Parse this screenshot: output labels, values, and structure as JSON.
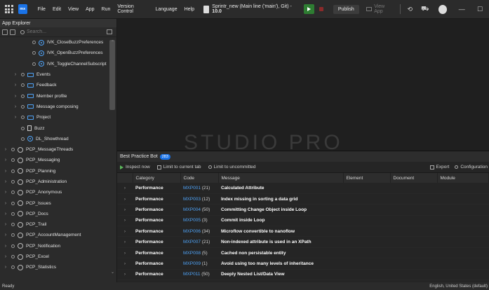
{
  "topbar": {
    "app_badge": "mx",
    "menu": [
      "File",
      "Edit",
      "View",
      "App",
      "Run",
      "Version Control",
      "Language",
      "Help"
    ],
    "project_name": "Sprintr_new (Main line ('main'), Git)",
    "project_sep": " - ",
    "project_version": "10.0",
    "publish_label": "Publish",
    "view_app_label": "View App"
  },
  "explorer": {
    "title": "App Explorer",
    "search_placeholder": "Search...",
    "items": [
      {
        "label": "IVK_CloseBuzzPreferences",
        "kind": "microflow",
        "indent": 38
      },
      {
        "label": "IVK_OpenBuzzPreferences",
        "kind": "microflow",
        "indent": 38
      },
      {
        "label": "IVK_ToggleChannelSubscript",
        "kind": "microflow",
        "indent": 38
      },
      {
        "label": "Events",
        "kind": "folder",
        "indent": 28
      },
      {
        "label": "Feedback",
        "kind": "folder",
        "indent": 28
      },
      {
        "label": "Member profile",
        "kind": "folder",
        "indent": 28
      },
      {
        "label": "Message composing",
        "kind": "folder",
        "indent": 28
      },
      {
        "label": "Project",
        "kind": "folder",
        "indent": 28
      },
      {
        "label": "Buzz",
        "kind": "doc",
        "indent": 28
      },
      {
        "label": "DL_Showthread",
        "kind": "microflow",
        "indent": 28
      },
      {
        "label": "PCP_MessageThreads",
        "kind": "module",
        "indent": 14
      },
      {
        "label": "PCP_Messaging",
        "kind": "module",
        "indent": 14
      },
      {
        "label": "PCP_Planning",
        "kind": "module",
        "indent": 14
      },
      {
        "label": "PCP_Administration",
        "kind": "module",
        "indent": 14
      },
      {
        "label": "PCP_Anonymous",
        "kind": "module",
        "indent": 14
      },
      {
        "label": "PCP_Issues",
        "kind": "module",
        "indent": 14
      },
      {
        "label": "PCP_Docs",
        "kind": "module",
        "indent": 14
      },
      {
        "label": "PCP_Trail",
        "kind": "module",
        "indent": 14
      },
      {
        "label": "PCP_AccountManagement",
        "kind": "module",
        "indent": 14
      },
      {
        "label": "PCP_Notification",
        "kind": "module",
        "indent": 14
      },
      {
        "label": "PCP_Excel",
        "kind": "module",
        "indent": 14
      },
      {
        "label": "PCP_Statistics",
        "kind": "module",
        "indent": 14
      }
    ]
  },
  "editor": {
    "watermark": "STUDIO PRO"
  },
  "panel": {
    "tab_label": "Best Practice Bot",
    "tab_count": "283",
    "inspect_label": "Inspect now",
    "limit_tab_label": "Limit to current tab",
    "limit_uncommitted_label": "Limit to uncommitted",
    "export_label": "Export",
    "config_label": "Configuration",
    "columns": [
      "Category",
      "Code",
      "Message",
      "Element",
      "Document",
      "Module"
    ],
    "rows": [
      {
        "category": "Performance",
        "code": "MXP001",
        "count": "(21)",
        "message": "Calculated Attribute"
      },
      {
        "category": "Performance",
        "code": "MXP003",
        "count": "(12)",
        "message": "Index missing in sorting a data grid"
      },
      {
        "category": "Performance",
        "code": "MXP004",
        "count": "(50)",
        "message": "Committing Change Object inside Loop"
      },
      {
        "category": "Performance",
        "code": "MXP005",
        "count": "(3)",
        "message": "Commit inside Loop"
      },
      {
        "category": "Performance",
        "code": "MXP006",
        "count": "(34)",
        "message": "Microflow convertible to nanoflow"
      },
      {
        "category": "Performance",
        "code": "MXP007",
        "count": "(21)",
        "message": "Non-indexed attribute is used in an XPath"
      },
      {
        "category": "Performance",
        "code": "MXP008",
        "count": "(5)",
        "message": "Cached non persistable entity"
      },
      {
        "category": "Performance",
        "code": "MXP009",
        "count": "(1)",
        "message": "Avoid using too many levels of inheritance"
      },
      {
        "category": "Performance",
        "code": "MXP011",
        "count": "(50)",
        "message": "Deeply Nested List/Data View"
      }
    ]
  },
  "status": {
    "left": "Ready",
    "language": "English, United States (default)"
  }
}
